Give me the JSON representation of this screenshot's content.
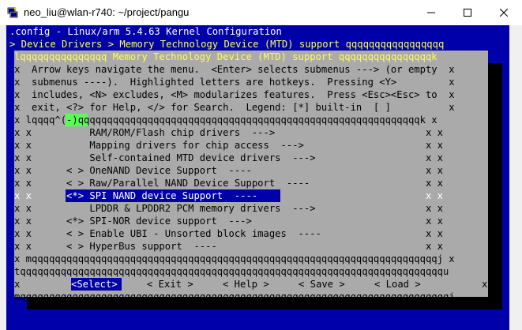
{
  "window": {
    "title": "neo_liu@wlan-r740: ~/project/pangu",
    "icon": "putty-icon",
    "controls": [
      "minimize-icon",
      "maximize-icon",
      "close-icon"
    ]
  },
  "terminal": {
    "header_line": ".config - Linux/arm 5.4.63 Kernel Configuration",
    "breadcrumb_line": "> Device Drivers > Memory Technology Device (MTD) support qqqqqqqqqqqqqqqqq",
    "dialog_title_line": "lqqqqqqqqqqqqqqq Memory Technology Device (MTD) support qqqqqqqqqqqqqqqqk",
    "help_lines": [
      "x  Arrow keys navigate the menu.  <Enter> selects submenus ---> (or empty  x",
      "x  submenus ----).  Highlighted letters are hotkeys.  Pressing <Y>         x",
      "x  includes, <N> excludes, <M> modularizes features.  Press <Esc><Esc> to  x",
      "x  exit, <?> for Help, </> for Search.  Legend: [*] built-in  [ ]          x"
    ],
    "list_top_line": "x lqqqq^(-)qqqqqqqqqqqqqqqqqqqqqqqqqqqqqqqqqqqqqqqqqqqqqqqqqqqqqqqqqqqk x",
    "menu_items": [
      {
        "text": "x x          RAM/ROM/Flash chip drivers  --->                          x x",
        "selected": false
      },
      {
        "text": "x x          Mapping drivers for chip access  --->                     x x",
        "selected": false
      },
      {
        "text": "x x          Self-contained MTD device drivers  --->                   x x",
        "selected": false
      },
      {
        "text": "x x      < > OneNAND Device Support  ----                              x x",
        "selected": false
      },
      {
        "text": "x x      < > Raw/Parallel NAND Device Support  ----                    x x",
        "selected": false
      },
      {
        "text": "x x      <*> SPI NAND device Support  ----                             x x",
        "selected": true
      },
      {
        "text": "x x          LPDDR & LPDDR2 PCM memory drivers  --->                   x x",
        "selected": false
      },
      {
        "text": "x x      <*> SPI-NOR device support  --->                              x x",
        "selected": false
      },
      {
        "text": "x x      < > Enable UBI - Unsorted block images  ----                  x x",
        "selected": false
      },
      {
        "text": "x x      < > HyperBus support  ----                                    x x",
        "selected": false
      }
    ],
    "list_bottom_line": "x mqqqqqqqqqqqqqqqqqqqqqqqqqqqqqqqqqqqqqqqqqqqqqqqqqqqqqqqqqqqqqqqqqqqqqqj x",
    "separator_line": "tqqqqqqqqqqqqqqqqqqqqqqqqqqqqqqqqqqqqqqqqqqqqqqqqqqqqqqqqqqqqqqqqqqqqqqqqqu",
    "buttons": [
      {
        "label": "<Select>",
        "selected": true
      },
      {
        "label": "< Exit >",
        "selected": false
      },
      {
        "label": "< Help >",
        "selected": false
      },
      {
        "label": "< Save >",
        "selected": false
      },
      {
        "label": "< Load >",
        "selected": false
      }
    ],
    "button_row_left": "x",
    "button_row_right": "x",
    "dialog_bottom_line": "mqqqqqqqqqqqqqqqqqqqqqqqqqqqqqqqqqqqqqqqqqqqqqqqqqqqqqqqqqqqqqqqqqqqqqqqqqqj"
  },
  "colors": {
    "terminal_bg": "#0000aa",
    "dialog_bg": "#aaaaaa",
    "header_fg": "#ffffff",
    "breadcrumb_fg": "#ffff55",
    "dialog_title_fg": "#ffff55",
    "hotkey_fg": "#ffff55",
    "text_fg": "#000000",
    "frame_fg": "#ffffff",
    "shadow": "#000000",
    "selected_bg": "#0000aa",
    "selected_fg": "#ffffff",
    "scroll_arrow_bg": "#55ff55"
  }
}
